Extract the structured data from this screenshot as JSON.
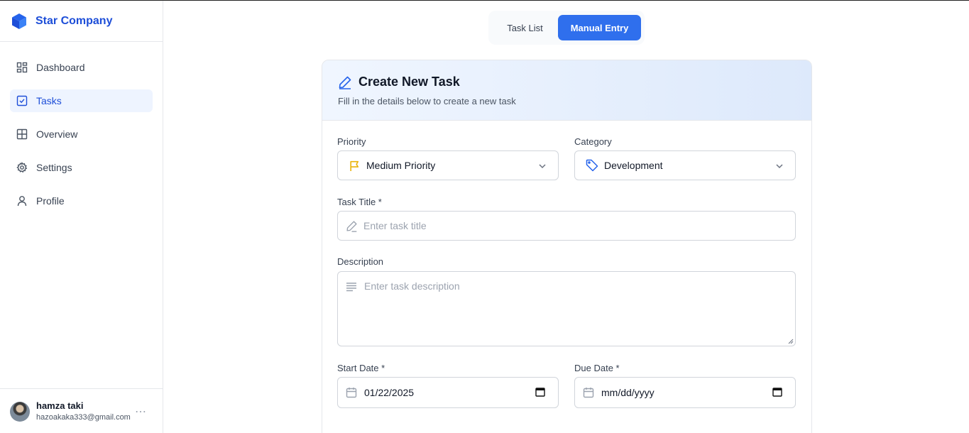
{
  "brand": {
    "name": "Star Company",
    "color": "#1d4ed8"
  },
  "sidebar": {
    "items": [
      {
        "label": "Dashboard",
        "icon": "dashboard-icon"
      },
      {
        "label": "Tasks",
        "icon": "tasks-icon",
        "active": true
      },
      {
        "label": "Overview",
        "icon": "grid-icon"
      },
      {
        "label": "Settings",
        "icon": "gear-icon"
      },
      {
        "label": "Profile",
        "icon": "user-icon"
      }
    ]
  },
  "user": {
    "name": "hamza taki",
    "email": "hazoakaka333@gmail.com",
    "more": "⋯"
  },
  "tabs": {
    "task_list": "Task List",
    "manual_entry": "Manual Entry",
    "active_color": "#2f6fed"
  },
  "form": {
    "title": "Create New Task",
    "subtitle": "Fill in the details below to create a new task",
    "priority": {
      "label": "Priority",
      "value": "Medium Priority",
      "icon": "flag-icon"
    },
    "category": {
      "label": "Category",
      "value": "Development",
      "icon": "tag-icon"
    },
    "task_title": {
      "label": "Task Title *",
      "placeholder": "Enter task title"
    },
    "description": {
      "label": "Description",
      "placeholder": "Enter task description"
    },
    "start_date": {
      "label": "Start Date *",
      "value": "01/22/2025"
    },
    "due_date": {
      "label": "Due Date *",
      "placeholder": "mm/dd/yyyy"
    }
  }
}
